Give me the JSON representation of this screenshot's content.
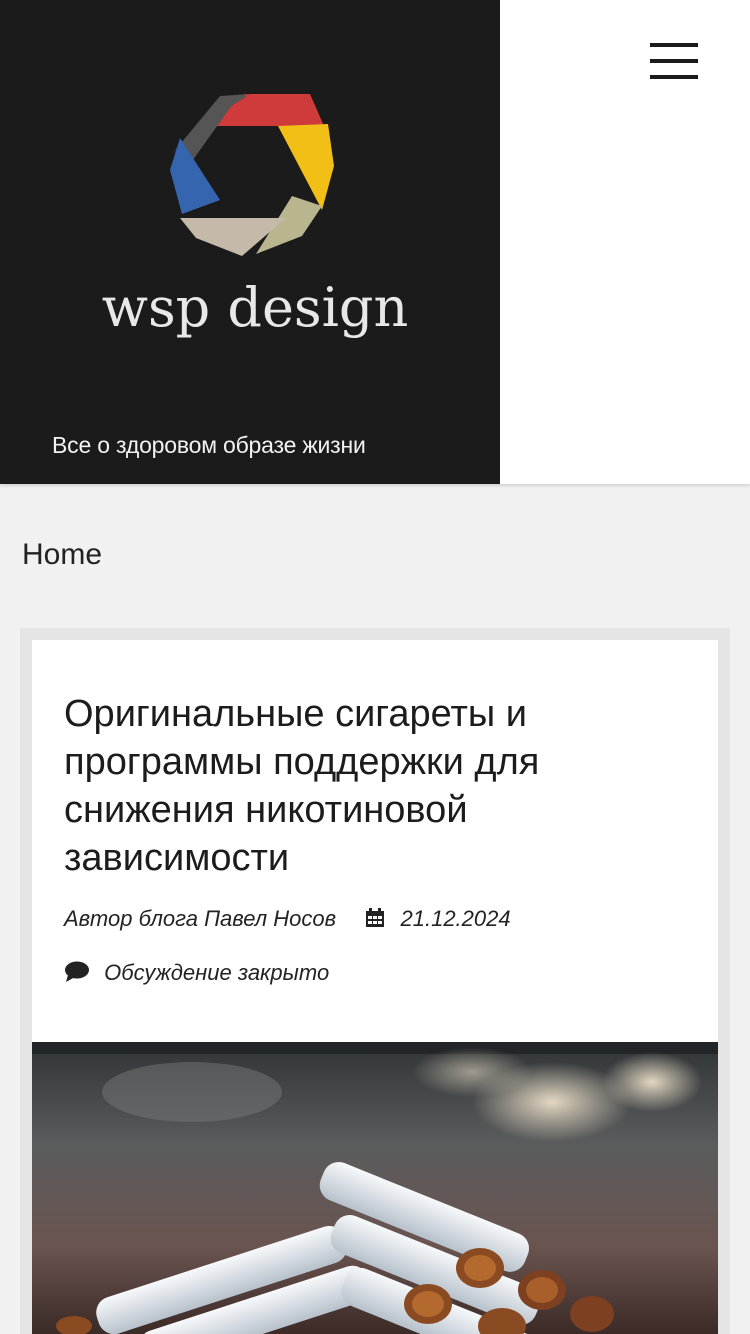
{
  "header": {
    "logo_text": "wsp design",
    "tagline": "Все о здоровом образе жизни",
    "menu_icon": "hamburger-menu-icon",
    "branding_bg": "#1b1b1c"
  },
  "breadcrumb": {
    "home": "Home"
  },
  "post": {
    "title": "Оригинальные сигареты и программы поддержки для снижения никотиновой зависимости",
    "author_prefix": "Автор блога",
    "author_name": "Павел Носов",
    "date": "21.12.2024",
    "date_icon": "calendar-icon",
    "comments": "Обсуждение закрыто",
    "comments_icon": "comment-icon"
  },
  "colors": {
    "aperture_red": "#cf3a3b",
    "aperture_yellow": "#f2bf16",
    "aperture_olive": "#b9b58f",
    "aperture_beige": "#c5b9a9",
    "aperture_blue": "#3665b0",
    "aperture_gray": "#555555"
  }
}
